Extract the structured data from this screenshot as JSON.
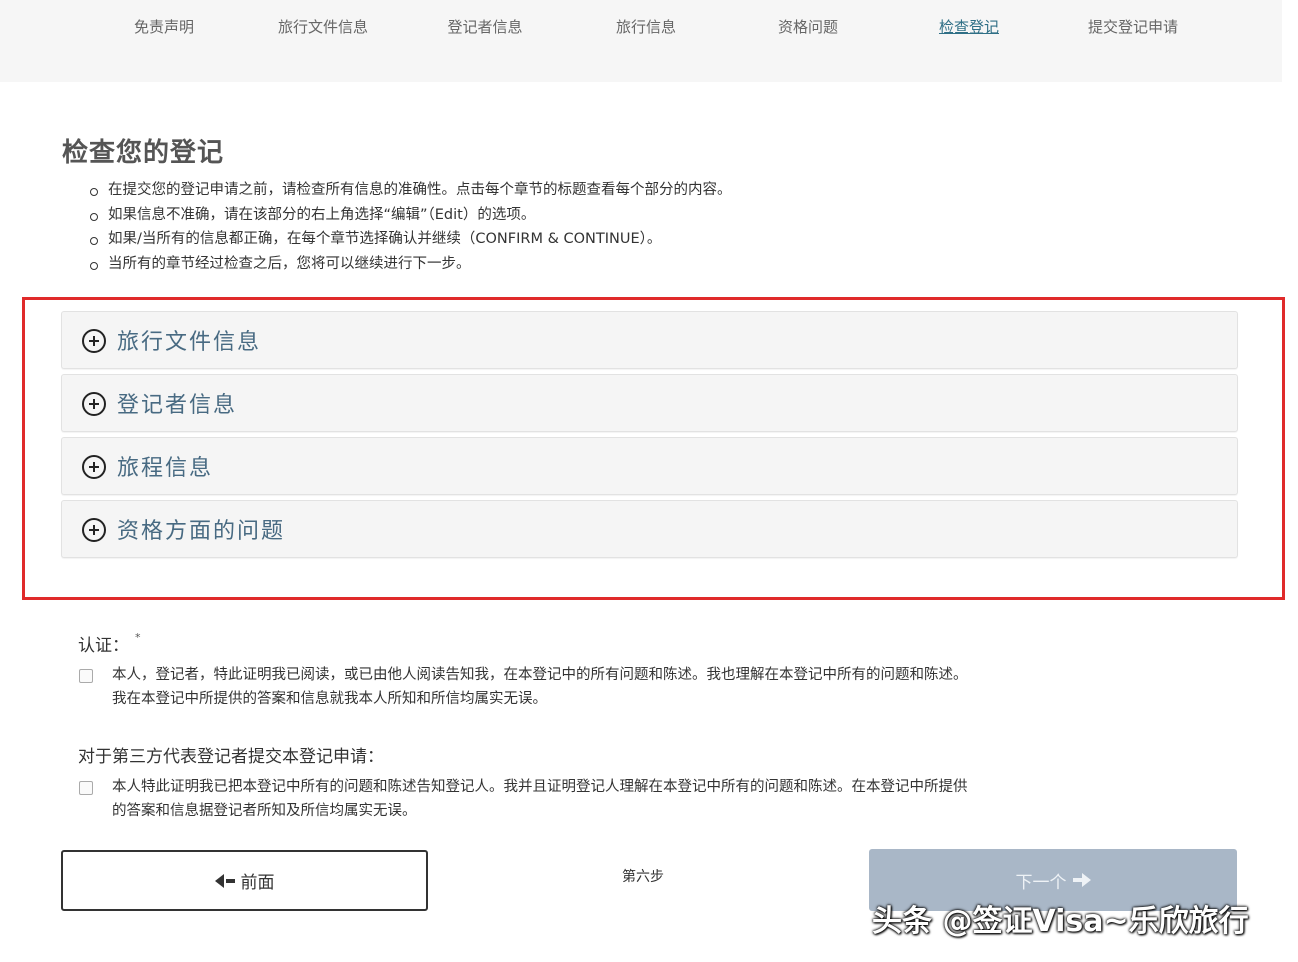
{
  "nav": {
    "items": [
      {
        "label": "免责声明"
      },
      {
        "label": "旅行文件信息"
      },
      {
        "label": "登记者信息"
      },
      {
        "label": "旅行信息"
      },
      {
        "label": "资格问题"
      },
      {
        "label": "检查登记",
        "active": true
      },
      {
        "label": "提交登记申请"
      }
    ]
  },
  "page": {
    "title": "检查您的登记",
    "instructions": [
      "在提交您的登记申请之前，请检查所有信息的准确性。点击每个章节的标题查看每个部分的内容。",
      "如果信息不准确，请在该部分的右上角选择“编辑”（Edit）的选项。",
      "如果/当所有的信息都正确，在每个章节选择确认并继续（CONFIRM & CONTINUE）。",
      "当所有的章节经过检查之后，您将可以继续进行下一步。"
    ]
  },
  "sections": [
    {
      "title": "旅行文件信息"
    },
    {
      "title": "登记者信息"
    },
    {
      "title": "旅程信息"
    },
    {
      "title": "资格方面的问题"
    }
  ],
  "certification": {
    "label": "认证：",
    "required_mark": "*",
    "statement_line1": "本人，登记者，特此证明我已阅读，或已由他人阅读告知我，在本登记中的所有问题和陈述。我也理解在本登记中所有的问题和陈述。",
    "statement_line2": "我在本登记中所提供的答案和信息就我本人所知和所信均属实无误。"
  },
  "third_party": {
    "label": "对于第三方代表登记者提交本登记申请：",
    "statement_line1": "本人特此证明我已把本登记中所有的问题和陈述告知登记人。我并且证明登记人理解在本登记中所有的问题和陈述。在本登记中所提供",
    "statement_line2": "的答案和信息据登记者所知及所信均属实无误。"
  },
  "footer": {
    "prev_label": "前面",
    "step_label": "第六步",
    "next_label": "下一个"
  },
  "watermark": "头条 @签证Visa~乐欣旅行",
  "colors": {
    "highlight_frame": "#e02a2a",
    "panel_title": "#486a82",
    "nav_active": "#2f6f86",
    "next_button_disabled": "#a9b7c7"
  },
  "icons": {
    "section_expand": "plus-circle-icon",
    "prev": "arrow-left-icon",
    "next": "arrow-right-icon"
  }
}
